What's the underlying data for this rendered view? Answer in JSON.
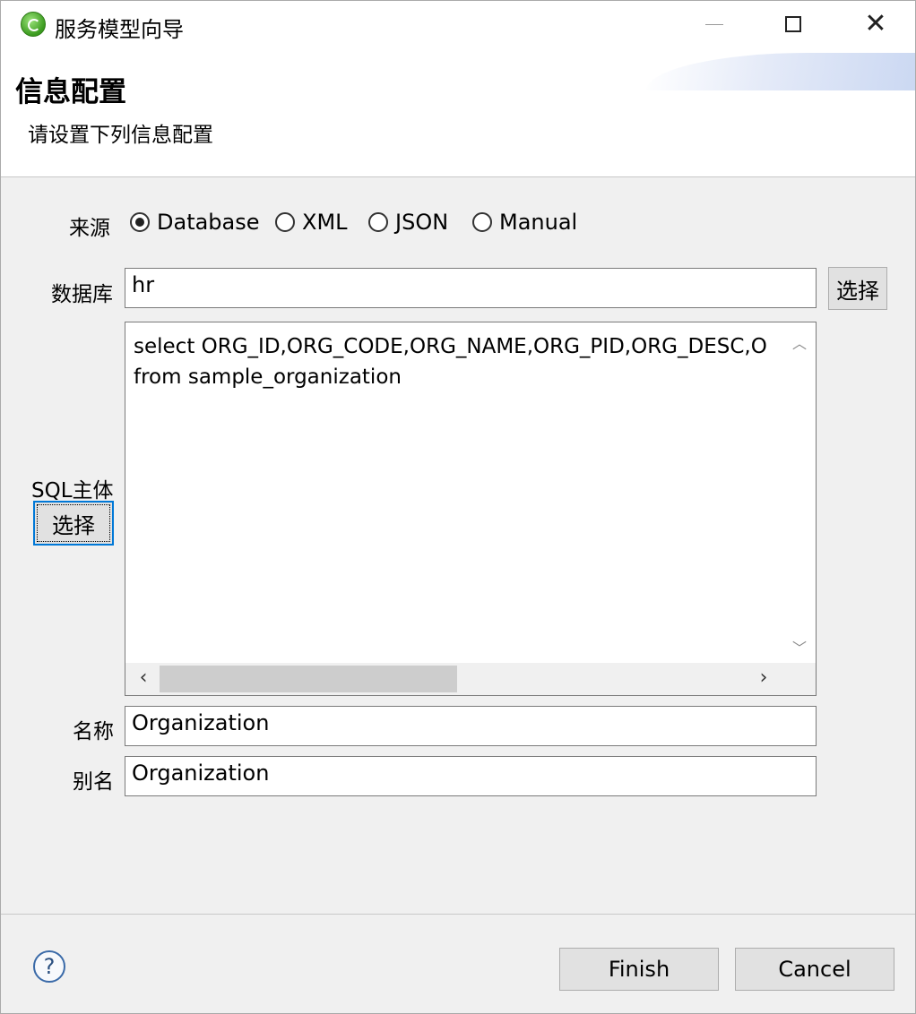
{
  "window": {
    "title": "服务模型向导"
  },
  "header": {
    "title": "信息配置",
    "subtitle": "请设置下列信息配置"
  },
  "source": {
    "label": "来源",
    "options": [
      "Database",
      "XML",
      "JSON",
      "Manual"
    ],
    "selected": "Database"
  },
  "database": {
    "label": "数据库",
    "value": "hr",
    "select_label": "选择"
  },
  "sql": {
    "label": "SQL主体",
    "select_label": "选择",
    "lines": [
      "select ORG_ID,ORG_CODE,ORG_NAME,ORG_PID,ORG_DESC,O",
      "from sample_organization"
    ]
  },
  "name": {
    "label": "名称",
    "value": "Organization"
  },
  "alias": {
    "label": "别名",
    "value": "Organization"
  },
  "footer": {
    "help": "?",
    "finish_label": "Finish",
    "cancel_label": "Cancel"
  },
  "icons": {
    "app": "app-logo-icon",
    "minimize": "minimize-icon",
    "maximize": "maximize-icon",
    "close": "close-icon",
    "help": "help-icon",
    "scroll_up": "chevron-up-icon",
    "scroll_down": "chevron-down-icon",
    "scroll_left": "chevron-left-icon",
    "scroll_right": "chevron-right-icon"
  }
}
